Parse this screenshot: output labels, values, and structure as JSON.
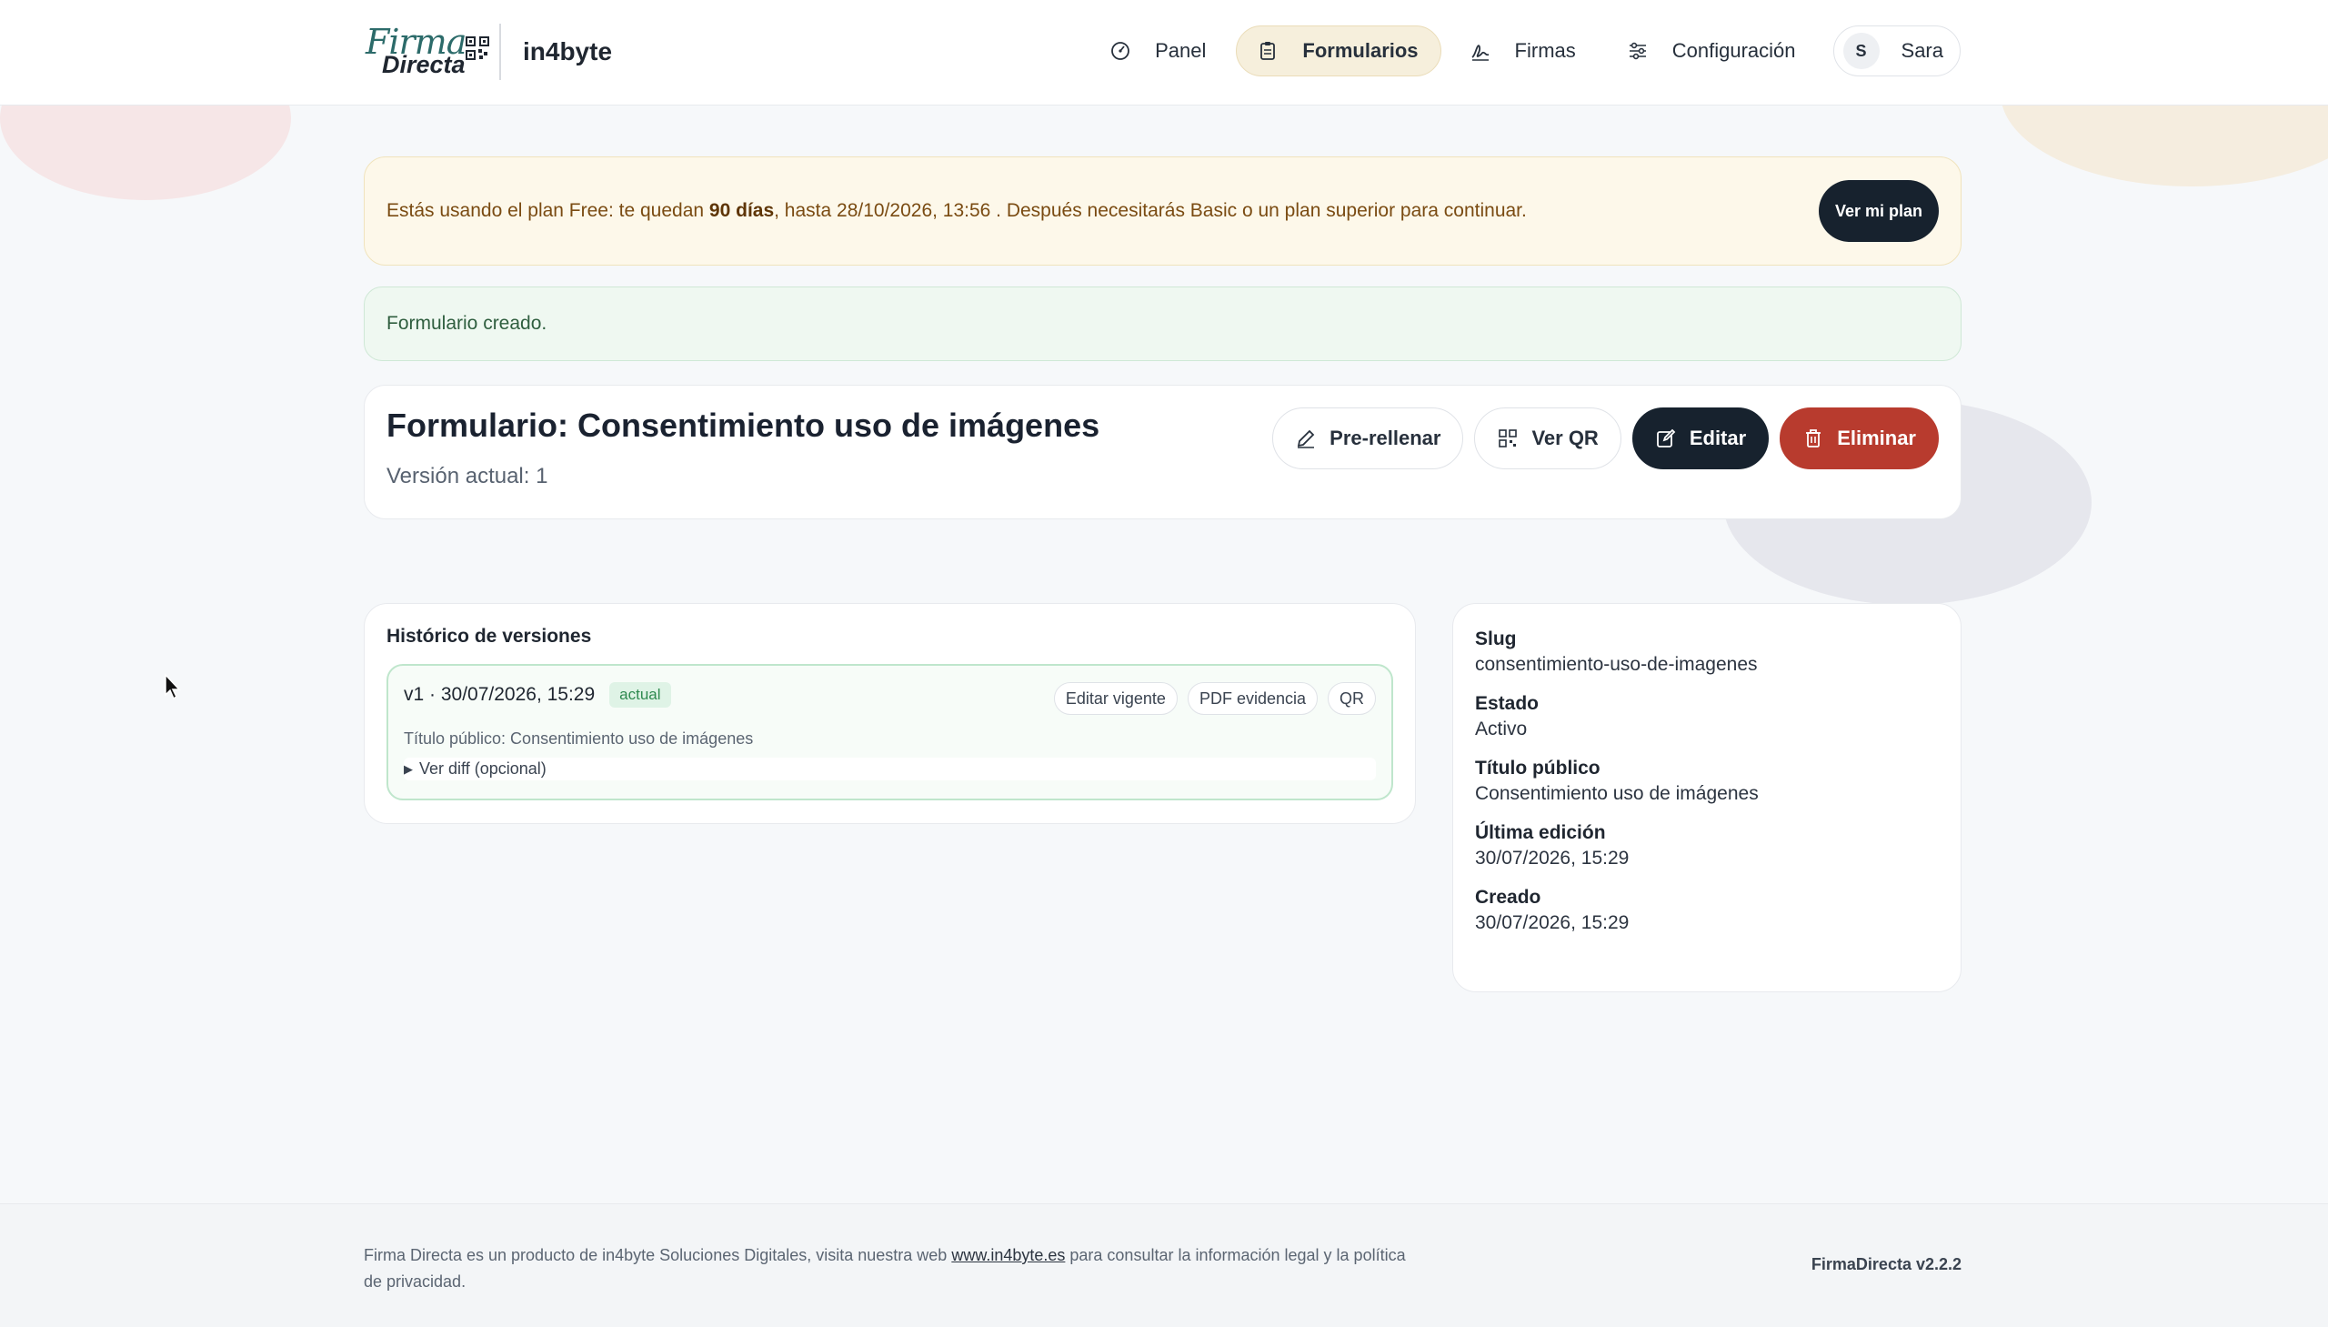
{
  "header": {
    "logo_top": "Firma",
    "logo_bottom": "Directa",
    "org": "in4byte",
    "nav": [
      {
        "label": "Panel",
        "icon": "gauge-icon"
      },
      {
        "label": "Formularios",
        "icon": "clipboard-icon",
        "active": true
      },
      {
        "label": "Firmas",
        "icon": "signature-icon"
      },
      {
        "label": "Configuración",
        "icon": "sliders-icon"
      }
    ],
    "user": {
      "initial": "S",
      "name": "Sara"
    }
  },
  "plan_banner": {
    "text_before": "Estás usando el plan Free: te quedan ",
    "days": "90 días",
    "text_after": ", hasta 28/10/2026, 13:56 . Después necesitarás Basic o un plan superior para continuar.",
    "button": "Ver mi plan"
  },
  "flash": "Formulario creado.",
  "form": {
    "title": "Formulario: Consentimiento uso de imágenes",
    "version": "Versión actual: 1",
    "actions": {
      "prefill": "Pre-rellenar",
      "qr": "Ver QR",
      "edit": "Editar",
      "delete": "Eliminar"
    }
  },
  "history": {
    "title": "Histórico de versiones",
    "version": {
      "label": "v1 · 30/07/2026, 15:29",
      "badge": "actual",
      "actions": [
        "Editar vigente",
        "PDF evidencia",
        "QR"
      ],
      "public_title": "Título público: Consentimiento uso de imágenes",
      "diff": "Ver diff (opcional)"
    }
  },
  "meta": [
    {
      "key": "Slug",
      "value": "consentimiento-uso-de-imagenes"
    },
    {
      "key": "Estado",
      "value": "Activo"
    },
    {
      "key": "Título público",
      "value": "Consentimiento uso de imágenes"
    },
    {
      "key": "Última edición",
      "value": "30/07/2026, 15:29"
    },
    {
      "key": "Creado",
      "value": "30/07/2026, 15:29"
    }
  ],
  "footer": {
    "text_before": "Firma Directa es un producto de in4byte Soluciones Digitales, visita nuestra web ",
    "link": "www.in4byte.es",
    "text_after": " para consultar la información legal y la política de privacidad.",
    "version": "FirmaDirecta v2.2.2"
  },
  "colors": {
    "accent_dark": "#17222e",
    "danger": "#b83b2e",
    "success_bg": "#eff8f1",
    "warning_bg": "#fdf8ea",
    "active_nav": "#f6efdc"
  }
}
